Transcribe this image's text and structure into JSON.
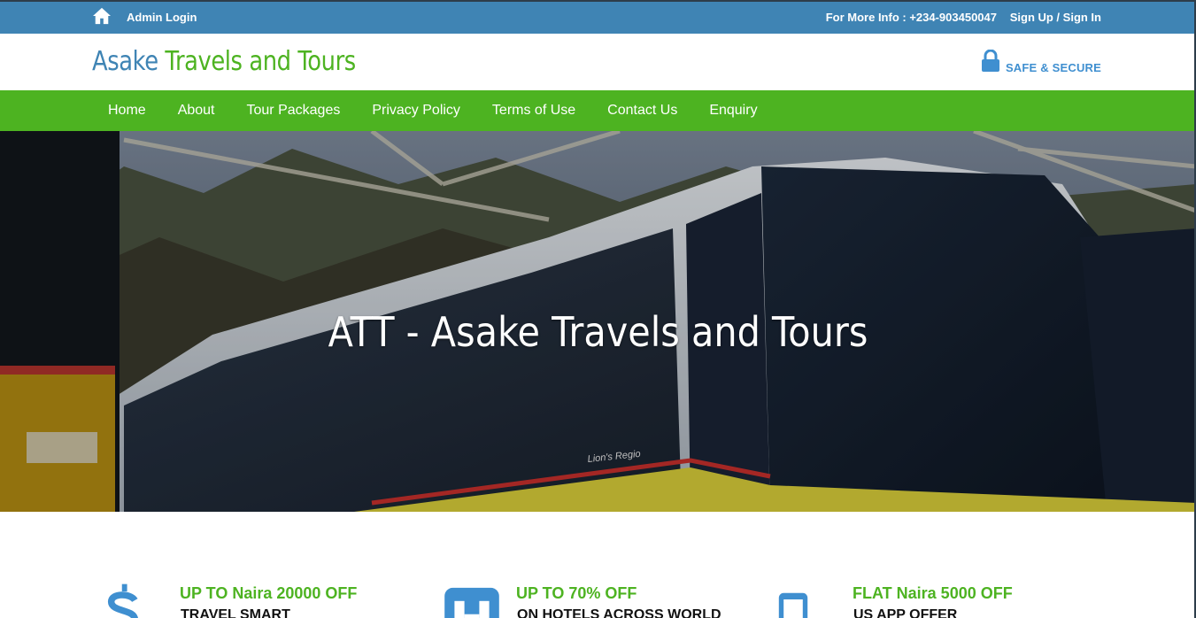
{
  "topbar": {
    "home_icon": "home-icon",
    "admin_login": "Admin Login",
    "more_info": "For More Info : +234-903450047",
    "sign_up": "Sign Up / Sign In"
  },
  "header": {
    "logo_part1": "Asake",
    "logo_part2": "Travels and Tours",
    "lock_icon": "lock-icon",
    "secure_text": "SAFE & SECURE"
  },
  "nav": {
    "items": [
      "Home",
      "About",
      "Tour Packages",
      "Privacy Policy",
      "Terms of Use",
      "Contact Us",
      "Enquiry"
    ]
  },
  "hero": {
    "title": "ATT - Asake Travels and Tours",
    "bus_lettering": "Lion's Regio"
  },
  "offers": [
    {
      "icon": "dollar-icon",
      "title": "UP TO Naira 20000 OFF",
      "subtitle": "TRAVEL SMART"
    },
    {
      "icon": "hotel-icon",
      "title": "UP TO 70% OFF",
      "subtitle": "ON HOTELS ACROSS WORLD"
    },
    {
      "icon": "mobile-icon",
      "title": "FLAT Naira 5000 OFF",
      "subtitle": "US APP OFFER"
    }
  ],
  "colors": {
    "topbar": "#3f84b4",
    "nav": "#4db321",
    "accent_green": "#4db321",
    "accent_blue": "#3f84b4"
  }
}
